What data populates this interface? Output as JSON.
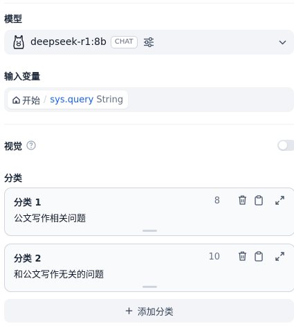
{
  "model": {
    "section_label": "模型",
    "name": "deepseek-r1:8b",
    "mode_badge": "CHAT",
    "icon": "llama-icon",
    "settings_icon": "sliders-icon",
    "dropdown_icon": "chevron-down-icon"
  },
  "input_variable": {
    "section_label": "输入变量",
    "node": "开始",
    "separator": "/",
    "variable": "sys.query",
    "type": "String",
    "node_icon": "home-icon"
  },
  "vision": {
    "label": "视觉",
    "help_icon": "help-circle-icon",
    "enabled": false
  },
  "classes": {
    "section_label": "分类",
    "items": [
      {
        "title": "分类 1",
        "count": "8",
        "text": "公文写作相关问题"
      },
      {
        "title": "分类 2",
        "count": "10",
        "text": "和公文写作无关的问题"
      }
    ],
    "add_label": "添加分类",
    "add_icon": "plus-icon"
  },
  "colors": {
    "field_bg": "#f2f4f7",
    "card_border": "#d0d5dd",
    "accent": "#155eef",
    "text": "#101828",
    "muted": "#667085"
  }
}
